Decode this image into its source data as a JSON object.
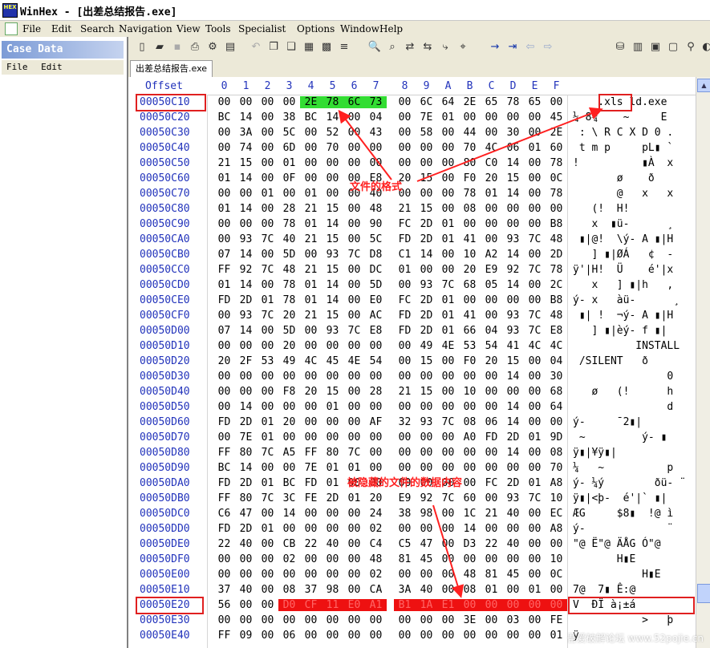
{
  "window": {
    "title": "WinHex - [出差总结报告.exe]",
    "icon_label": "HEX"
  },
  "menubar": {
    "items": [
      "File",
      "Edit",
      "Search",
      "Navigation",
      "View",
      "Tools",
      "Specialist",
      "Options",
      "Window",
      "Help"
    ]
  },
  "case_panel": {
    "title": "Case Data",
    "menu": [
      "File",
      "Edit"
    ]
  },
  "tab": {
    "label": "出差总结报告.exe"
  },
  "header": {
    "offset_label": "Offset",
    "columns": [
      "0",
      "1",
      "2",
      "3",
      "4",
      "5",
      "6",
      "7",
      "8",
      "9",
      "A",
      "B",
      "C",
      "D",
      "E",
      "F"
    ]
  },
  "rows": [
    {
      "offset": "00050C10",
      "bytes": [
        "00",
        "00",
        "00",
        "00",
        "2E",
        "78",
        "6C",
        "73",
        "00",
        "6C",
        "64",
        "2E",
        "65",
        "78",
        "65",
        "00"
      ],
      "text": "    .xls ld.exe"
    },
    {
      "offset": "00050C20",
      "bytes": [
        "BC",
        "14",
        "00",
        "38",
        "BC",
        "14",
        "00",
        "04",
        "00",
        "7E",
        "01",
        "00",
        "00",
        "00",
        "00",
        "45"
      ],
      "text": "¼ 8¼    ~     E"
    },
    {
      "offset": "00050C30",
      "bytes": [
        "00",
        "3A",
        "00",
        "5C",
        "00",
        "52",
        "00",
        "43",
        "00",
        "58",
        "00",
        "44",
        "00",
        "30",
        "00",
        "2E"
      ],
      "text": " : \\ R C X D 0 ."
    },
    {
      "offset": "00050C40",
      "bytes": [
        "00",
        "74",
        "00",
        "6D",
        "00",
        "70",
        "00",
        "00",
        "00",
        "00",
        "00",
        "70",
        "4C",
        "06",
        "01",
        "60"
      ],
      "text": " t m p     pL▮ `"
    },
    {
      "offset": "00050C50",
      "bytes": [
        "21",
        "15",
        "00",
        "01",
        "00",
        "00",
        "00",
        "00",
        "00",
        "00",
        "00",
        "80",
        "C0",
        "14",
        "00",
        "78"
      ],
      "text": "!          ▮À  x"
    },
    {
      "offset": "00050C60",
      "bytes": [
        "01",
        "14",
        "00",
        "0F",
        "00",
        "00",
        "00",
        "E8",
        "20",
        "15",
        "00",
        "F0",
        "20",
        "15",
        "00",
        "0C"
      ],
      "text": "       ø    ð"
    },
    {
      "offset": "00050C70",
      "bytes": [
        "00",
        "00",
        "01",
        "00",
        "01",
        "00",
        "00",
        "40",
        "00",
        "00",
        "00",
        "78",
        "01",
        "14",
        "00",
        "78"
      ],
      "text": "       @   x   x"
    },
    {
      "offset": "00050C80",
      "bytes": [
        "01",
        "14",
        "00",
        "28",
        "21",
        "15",
        "00",
        "48",
        "21",
        "15",
        "00",
        "08",
        "00",
        "00",
        "00",
        "00"
      ],
      "text": "   (!  H!"
    },
    {
      "offset": "00050C90",
      "bytes": [
        "00",
        "00",
        "00",
        "78",
        "01",
        "14",
        "00",
        "90",
        "FC",
        "2D",
        "01",
        "00",
        "00",
        "00",
        "00",
        "B8"
      ],
      "text": "   x  ▮ü-      ¸"
    },
    {
      "offset": "00050CA0",
      "bytes": [
        "00",
        "93",
        "7C",
        "40",
        "21",
        "15",
        "00",
        "5C",
        "FD",
        "2D",
        "01",
        "41",
        "00",
        "93",
        "7C",
        "48"
      ],
      "text": " ▮|@!  \\ý- A ▮|H"
    },
    {
      "offset": "00050CB0",
      "bytes": [
        "07",
        "14",
        "00",
        "5D",
        "00",
        "93",
        "7C",
        "D8",
        "C1",
        "14",
        "00",
        "10",
        "A2",
        "14",
        "00",
        "2D"
      ],
      "text": "   ] ▮|ØÁ   ¢  -"
    },
    {
      "offset": "00050CC0",
      "bytes": [
        "FF",
        "92",
        "7C",
        "48",
        "21",
        "15",
        "00",
        "DC",
        "01",
        "00",
        "00",
        "20",
        "E9",
        "92",
        "7C",
        "78"
      ],
      "text": "ÿ'|H!  Ü    é'|x"
    },
    {
      "offset": "00050CD0",
      "bytes": [
        "01",
        "14",
        "00",
        "78",
        "01",
        "14",
        "00",
        "5D",
        "00",
        "93",
        "7C",
        "68",
        "05",
        "14",
        "00",
        "2C"
      ],
      "text": "   x   ] ▮|h   ,"
    },
    {
      "offset": "00050CE0",
      "bytes": [
        "FD",
        "2D",
        "01",
        "78",
        "01",
        "14",
        "00",
        "E0",
        "FC",
        "2D",
        "01",
        "00",
        "00",
        "00",
        "00",
        "B8"
      ],
      "text": "ý- x   àü-      ¸"
    },
    {
      "offset": "00050CF0",
      "bytes": [
        "00",
        "93",
        "7C",
        "20",
        "21",
        "15",
        "00",
        "AC",
        "FD",
        "2D",
        "01",
        "41",
        "00",
        "93",
        "7C",
        "48"
      ],
      "text": " ▮| !  ¬ý- A ▮|H"
    },
    {
      "offset": "00050D00",
      "bytes": [
        "07",
        "14",
        "00",
        "5D",
        "00",
        "93",
        "7C",
        "E8",
        "FD",
        "2D",
        "01",
        "66",
        "04",
        "93",
        "7C",
        "E8"
      ],
      "text": "   ] ▮|èý- f ▮|"
    },
    {
      "offset": "00050D10",
      "bytes": [
        "00",
        "00",
        "00",
        "20",
        "00",
        "00",
        "00",
        "00",
        "00",
        "49",
        "4E",
        "53",
        "54",
        "41",
        "4C",
        "4C"
      ],
      "text": "          INSTALL"
    },
    {
      "offset": "00050D20",
      "bytes": [
        "20",
        "2F",
        "53",
        "49",
        "4C",
        "45",
        "4E",
        "54",
        "00",
        "15",
        "00",
        "F0",
        "20",
        "15",
        "00",
        "04"
      ],
      "text": " /SILENT   ð"
    },
    {
      "offset": "00050D30",
      "bytes": [
        "00",
        "00",
        "00",
        "00",
        "00",
        "00",
        "00",
        "00",
        "00",
        "00",
        "00",
        "00",
        "00",
        "14",
        "00",
        "30"
      ],
      "text": "               0"
    },
    {
      "offset": "00050D40",
      "bytes": [
        "00",
        "00",
        "00",
        "F8",
        "20",
        "15",
        "00",
        "28",
        "21",
        "15",
        "00",
        "10",
        "00",
        "00",
        "00",
        "68"
      ],
      "text": "   ø   (!      h"
    },
    {
      "offset": "00050D50",
      "bytes": [
        "00",
        "14",
        "00",
        "00",
        "00",
        "01",
        "00",
        "00",
        "00",
        "00",
        "00",
        "00",
        "00",
        "14",
        "00",
        "64"
      ],
      "text": "               d"
    },
    {
      "offset": "00050D60",
      "bytes": [
        "FD",
        "2D",
        "01",
        "20",
        "00",
        "00",
        "00",
        "AF",
        "32",
        "93",
        "7C",
        "08",
        "06",
        "14",
        "00",
        "00"
      ],
      "text": "ý-     ¯2▮|"
    },
    {
      "offset": "00050D70",
      "bytes": [
        "00",
        "7E",
        "01",
        "00",
        "00",
        "00",
        "00",
        "00",
        "00",
        "00",
        "00",
        "A0",
        "FD",
        "2D",
        "01",
        "9D"
      ],
      "text": " ~         ý- ▮"
    },
    {
      "offset": "00050D80",
      "bytes": [
        "FF",
        "80",
        "7C",
        "A5",
        "FF",
        "80",
        "7C",
        "00",
        "00",
        "00",
        "00",
        "00",
        "00",
        "14",
        "00",
        "08"
      ],
      "text": "ÿ▮|¥ÿ▮|"
    },
    {
      "offset": "00050D90",
      "bytes": [
        "BC",
        "14",
        "00",
        "00",
        "7E",
        "01",
        "01",
        "00",
        "00",
        "00",
        "00",
        "00",
        "00",
        "00",
        "00",
        "70"
      ],
      "text": "¼   ~          p"
    },
    {
      "offset": "00050DA0",
      "bytes": [
        "FD",
        "2D",
        "01",
        "BC",
        "FD",
        "01",
        "00",
        "00",
        "00",
        "00",
        "00",
        "00",
        "FC",
        "2D",
        "01",
        "A8"
      ],
      "text": "ý- ¼ý        ðü- ¨"
    },
    {
      "offset": "00050DB0",
      "bytes": [
        "FF",
        "80",
        "7C",
        "3C",
        "FE",
        "2D",
        "01",
        "20",
        "E9",
        "92",
        "7C",
        "60",
        "00",
        "93",
        "7C",
        "10"
      ],
      "text": "ÿ▮|<þ-  é'|` ▮|"
    },
    {
      "offset": "00050DC0",
      "bytes": [
        "C6",
        "47",
        "00",
        "14",
        "00",
        "00",
        "00",
        "24",
        "38",
        "98",
        "00",
        "1C",
        "21",
        "40",
        "00",
        "EC"
      ],
      "text": "ÆG     $8▮  !@ ì"
    },
    {
      "offset": "00050DD0",
      "bytes": [
        "FD",
        "2D",
        "01",
        "00",
        "00",
        "00",
        "00",
        "02",
        "00",
        "00",
        "00",
        "14",
        "00",
        "00",
        "00",
        "A8"
      ],
      "text": "ý-             ¨"
    },
    {
      "offset": "00050DE0",
      "bytes": [
        "22",
        "40",
        "00",
        "CB",
        "22",
        "40",
        "00",
        "C4",
        "C5",
        "47",
        "00",
        "D3",
        "22",
        "40",
        "00",
        "00"
      ],
      "text": "\"@ Ë\"@ ÄÅG Ó\"@"
    },
    {
      "offset": "00050DF0",
      "bytes": [
        "00",
        "00",
        "00",
        "02",
        "00",
        "00",
        "00",
        "48",
        "81",
        "45",
        "00",
        "00",
        "00",
        "00",
        "00",
        "10"
      ],
      "text": "       H▮E"
    },
    {
      "offset": "00050E00",
      "bytes": [
        "00",
        "00",
        "00",
        "00",
        "00",
        "00",
        "00",
        "02",
        "00",
        "00",
        "00",
        "48",
        "81",
        "45",
        "00",
        "0C"
      ],
      "text": "           H▮E"
    },
    {
      "offset": "00050E10",
      "bytes": [
        "37",
        "40",
        "00",
        "08",
        "37",
        "98",
        "00",
        "CA",
        "3A",
        "40",
        "00",
        "08",
        "01",
        "00",
        "01",
        "00"
      ],
      "text": "7@  7▮ Ê:@"
    },
    {
      "offset": "00050E20",
      "bytes": [
        "56",
        "00",
        "00",
        "D0",
        "CF",
        "11",
        "E0",
        "A1",
        "B1",
        "1A",
        "E1",
        "00",
        "00",
        "00",
        "00",
        "00"
      ],
      "text": "V  ÐÏ à¡±á"
    },
    {
      "offset": "00050E30",
      "bytes": [
        "00",
        "00",
        "00",
        "00",
        "00",
        "00",
        "00",
        "00",
        "00",
        "00",
        "00",
        "3E",
        "00",
        "03",
        "00",
        "FE"
      ],
      "text": "           >   þ"
    },
    {
      "offset": "00050E40",
      "bytes": [
        "FF",
        "09",
        "00",
        "06",
        "00",
        "00",
        "00",
        "00",
        "00",
        "00",
        "00",
        "00",
        "00",
        "00",
        "00",
        "01"
      ],
      "text": "ÿ"
    }
  ],
  "annotations": {
    "file_format": "文件的格式",
    "hidden_data": "被隐藏的文件的数据内容"
  },
  "watermark": "吾爱破解论坛 www.52pojie.cn",
  "colors": {
    "offset_blue": "#2233bb",
    "highlight_green": "#33dd33",
    "highlight_red": "#ee1111",
    "annotation_red": "#ff2020"
  }
}
